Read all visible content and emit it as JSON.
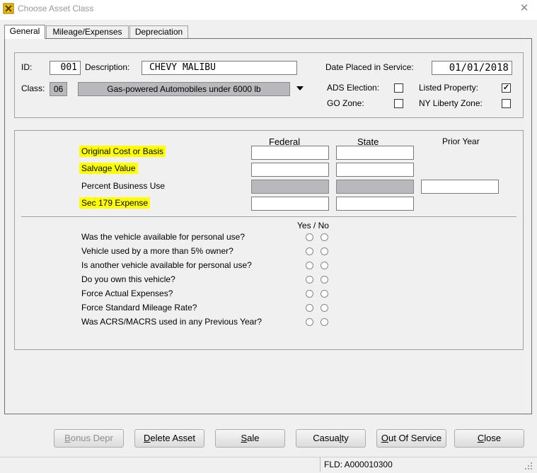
{
  "window": {
    "title": "Choose Asset Class",
    "close_glyph": "✕"
  },
  "tabs": [
    {
      "label": "General"
    },
    {
      "label": "Mileage/Expenses"
    },
    {
      "label": "Depreciation"
    }
  ],
  "asset": {
    "id_label": "ID:",
    "id_value": "001",
    "description_label": "Description:",
    "description_value": "CHEVY MALIBU",
    "date_label": "Date Placed in Service:",
    "date_value": "01/01/2018",
    "class_label": "Class:",
    "class_code": "06",
    "class_value": "Gas-powered Automobiles under 6000 lb",
    "ads_label": "ADS Election:",
    "ads_checked": false,
    "listed_label": "Listed Property:",
    "listed_checked": true,
    "go_zone_label": "GO Zone:",
    "go_zone_checked": false,
    "ny_liberty_label": "NY Liberty Zone:",
    "ny_liberty_checked": false,
    "check_glyph": "✓"
  },
  "cost": {
    "col_federal": "Federal",
    "col_state": "State",
    "col_prior": "Prior Year",
    "rows": [
      {
        "label": "Original Cost or Basis"
      },
      {
        "label": "Salvage Value"
      },
      {
        "label": "Percent Business Use"
      },
      {
        "label": "Sec 179 Expense"
      }
    ]
  },
  "questions": {
    "header": "Yes / No",
    "items": [
      "Was the vehicle available for personal use?",
      "Vehicle used by a more than 5% owner?",
      "Is another vehicle available for personal use?",
      "Do you own this vehicle?",
      "Force Actual Expenses?",
      "Force Standard Mileage Rate?",
      "Was ACRS/MACRS used in any Previous Year?"
    ]
  },
  "buttons": {
    "bonus": {
      "pre": "",
      "u": "B",
      "post": "onus Depr"
    },
    "delete": {
      "pre": "",
      "u": "D",
      "post": "elete Asset"
    },
    "sale": {
      "pre": "",
      "u": "S",
      "post": "ale"
    },
    "casualty": {
      "pre": "Casua",
      "u": "l",
      "post": "ty"
    },
    "out": {
      "pre": "",
      "u": "O",
      "post": "ut Of Service"
    },
    "close": {
      "pre": "",
      "u": "C",
      "post": "lose"
    }
  },
  "status": {
    "field": "FLD: A000010300"
  }
}
